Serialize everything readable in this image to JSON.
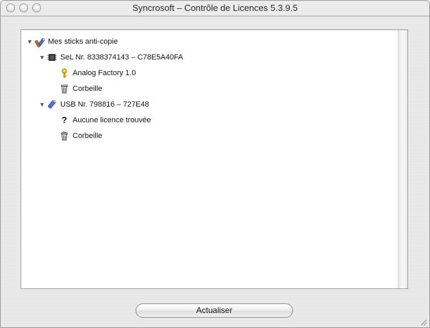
{
  "window": {
    "title": "Syncrosoft – Contrôle de Licences 5.3.9.5"
  },
  "tree": {
    "root": {
      "label": "Mes sticks anti-copie",
      "icon": "dongles-icon",
      "expanded": true
    },
    "devices": [
      {
        "label": "SeL Nr. 8338374143 – C78E5A40FA",
        "icon": "chip-icon",
        "expanded": true,
        "children": [
          {
            "label": "Analog Factory 1.0",
            "icon": "key-icon"
          },
          {
            "label": "Corbeille",
            "icon": "trash-icon"
          }
        ]
      },
      {
        "label": "USB Nr. 798816 – 727E48",
        "icon": "usb-stick-icon",
        "expanded": true,
        "children": [
          {
            "label": "Aucune licence trouvée",
            "icon": "question-icon"
          },
          {
            "label": "Corbeille",
            "icon": "trash-full-icon"
          }
        ]
      }
    ]
  },
  "footer": {
    "refresh_button": "Actualiser"
  }
}
